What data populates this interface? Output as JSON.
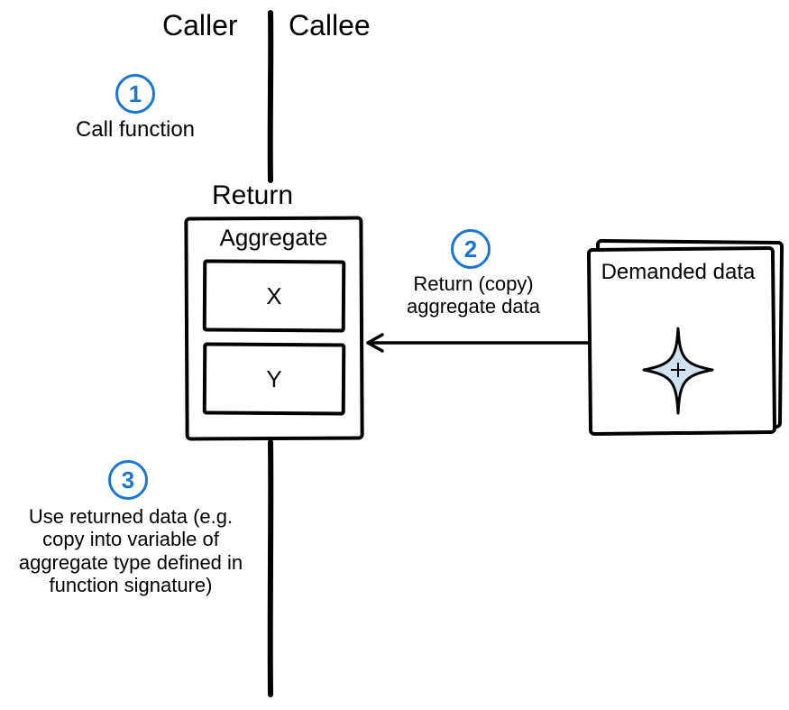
{
  "header": {
    "caller": "Caller",
    "callee": "Callee"
  },
  "steps": {
    "s1": {
      "num": "1",
      "label": "Call function"
    },
    "s2": {
      "num": "2",
      "label": "Return (copy)\naggregate data"
    },
    "s3": {
      "num": "3",
      "label": "Use returned data\n(e.g. copy into variable\nof aggregate type\ndefined in function\nsignature)"
    }
  },
  "return_box": {
    "title": "Return",
    "agg_label": "Aggregate",
    "field_x": "X",
    "field_y": "Y"
  },
  "demanded_box": {
    "label": "Demanded\ndata"
  }
}
